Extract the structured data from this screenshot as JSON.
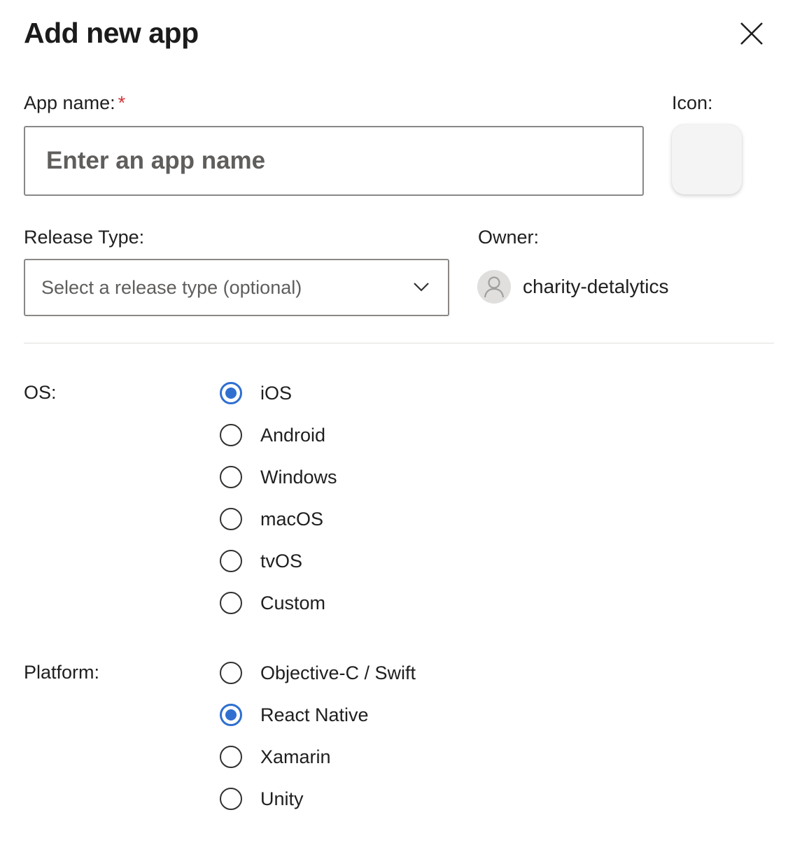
{
  "dialog": {
    "title": "Add new app",
    "close_icon": "close-icon"
  },
  "app_name": {
    "label": "App name:",
    "required_marker": "*",
    "placeholder": "Enter an app name",
    "value": ""
  },
  "icon": {
    "label": "Icon:"
  },
  "release_type": {
    "label": "Release Type:",
    "placeholder": "Select a release type (optional)",
    "chevron_icon": "chevron-down-icon"
  },
  "owner": {
    "label": "Owner:",
    "name": "charity-detalytics",
    "avatar_icon": "person-icon"
  },
  "os": {
    "label": "OS:",
    "options": [
      {
        "label": "iOS",
        "checked": true
      },
      {
        "label": "Android",
        "checked": false
      },
      {
        "label": "Windows",
        "checked": false
      },
      {
        "label": "macOS",
        "checked": false
      },
      {
        "label": "tvOS",
        "checked": false
      },
      {
        "label": "Custom",
        "checked": false
      }
    ]
  },
  "platform": {
    "label": "Platform:",
    "options": [
      {
        "label": "Objective-C / Swift",
        "checked": false
      },
      {
        "label": "React Native",
        "checked": true
      },
      {
        "label": "Xamarin",
        "checked": false
      },
      {
        "label": "Unity",
        "checked": false
      }
    ]
  },
  "colors": {
    "accent": "#2f6fd0",
    "required": "#d13438",
    "border": "#8a8886"
  }
}
